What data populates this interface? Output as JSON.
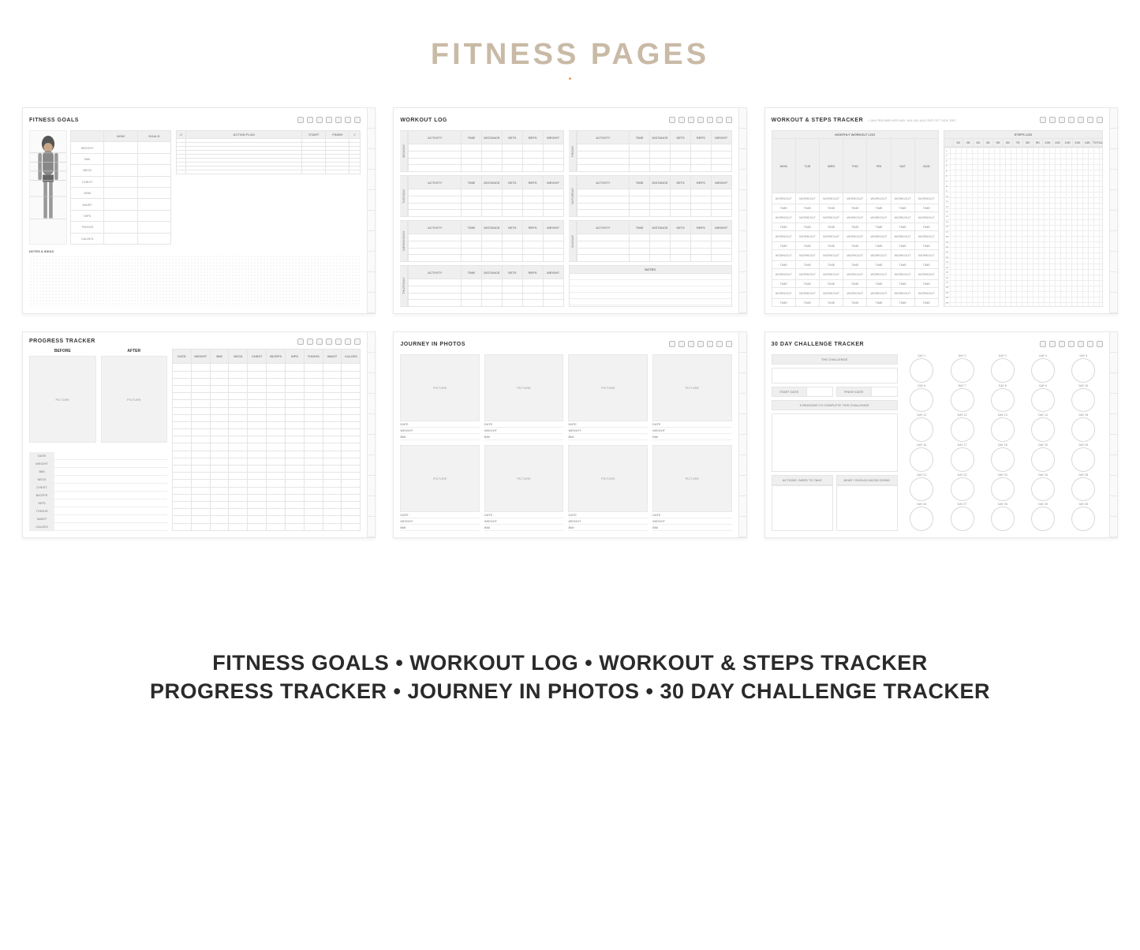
{
  "header": {
    "title": "FITNESS PAGES"
  },
  "footer": {
    "line1": "FITNESS GOALS • WORKOUT LOG • WORKOUT & STEPS TRACKER",
    "line2": "PROGRESS TRACKER • JOURNEY IN PHOTOS • 30 DAY CHALLENGE TRACKER"
  },
  "months": [
    "JAN",
    "FEB",
    "MAR",
    "APR",
    "MAY",
    "JUN",
    "JUL",
    "AUG",
    "SEP",
    "OCT",
    "NOV",
    "DEC"
  ],
  "weekdays": [
    "MON",
    "TUE",
    "WED",
    "THU",
    "FRI",
    "SAT",
    "SUN"
  ],
  "workout_cell": "WORKOUT",
  "time_cell": "TIME",
  "measurements": [
    "WEIGHT",
    "BMI",
    "NECK",
    "CHEST",
    "ARM",
    "WAIST",
    "HIPS",
    "THIGHS",
    "CALVES"
  ],
  "fitness_goals": {
    "title": "FITNESS GOALS",
    "now": "NOW",
    "goals": "GOALS",
    "num": "#",
    "action_plan": "ACTION PLAN",
    "start": "START",
    "finish": "FINISH",
    "check": "✓",
    "notes": "NOTES & IDEAS"
  },
  "workout_log": {
    "title": "WORKOUT LOG",
    "headers": [
      "ACTIVITY",
      "TIME",
      "DISTANCE",
      "SETS",
      "REPS",
      "WEIGHT"
    ],
    "days_left": [
      "MONDAY",
      "TUESDAY",
      "WEDNESDAY",
      "THURSDAY"
    ],
    "days_right": [
      "FRIDAY",
      "SATURDAY",
      "SUNDAY"
    ],
    "notes": "NOTES"
  },
  "workout_steps": {
    "title": "WORKOUT & STEPS TRACKER",
    "monthly_log": "MONTHLY WORKOUT LOG",
    "steps_log": "STEPS LOG",
    "steps_header": [
      "1K",
      "2K",
      "3K",
      "4K",
      "5K",
      "6K",
      "7K",
      "8K",
      "9K",
      "10K",
      "11K",
      "12K",
      "13K",
      "14K",
      "TOTAL"
    ]
  },
  "progress": {
    "title": "PROGRESS TRACKER",
    "before": "BEFORE",
    "after": "AFTER",
    "picture": "PICTURE",
    "headers": [
      "DATE",
      "WEIGHT",
      "BMI",
      "NECK",
      "CHEST",
      "BICEPS",
      "HIPS",
      "THIGHS",
      "WAIST",
      "CALVES"
    ],
    "rows": [
      "DATE",
      "WEIGHT",
      "BMI",
      "NECK",
      "CHEST",
      "BICEPS",
      "HIPS",
      "THIGHS",
      "WAIST",
      "CALVES"
    ]
  },
  "journey": {
    "title": "JOURNEY IN PHOTOS",
    "picture": "PICTURE",
    "meta": [
      "DATE",
      "WEIGHT",
      "BMI"
    ]
  },
  "challenge": {
    "title": "30 DAY CHALLENGE TRACKER",
    "the_challenge": "THE CHALLENGE",
    "start_date": "START DATE",
    "finish_date": "FINISH DATE",
    "reasons": "5 REASONS TO COMPLETE THIS CHALLENGE",
    "actions": "ACTIONS I NEED TO TAKE",
    "avoid": "WHAT I SHOULD AVOID DOING",
    "day_prefix": "DAY",
    "days": 30
  }
}
